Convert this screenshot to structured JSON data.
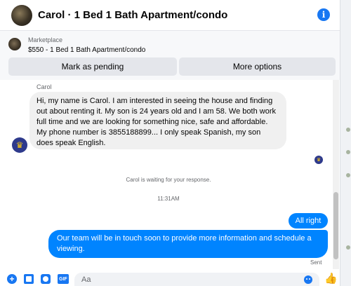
{
  "header": {
    "title": "Carol · 1 Bed 1 Bath Apartment/condo",
    "info_icon": "info-icon",
    "info_glyph": "i"
  },
  "marketplace": {
    "label": "Marketplace",
    "listing": "$550 - 1 Bed 1 Bath Apartment/condo",
    "mark_pending_label": "Mark as pending",
    "more_options_label": "More options"
  },
  "conversation": {
    "sender_name": "Carol",
    "incoming_message": "Hi, my name is Carol. I am interested in seeing the house and finding out about renting it. My son is 24 years old and I am 58. We both work full time and we are looking for something nice, safe and affordable. My phone number is 3855188899... I only speak Spanish, my son does speak English.",
    "waiting_notice": "Carol is waiting for your response.",
    "timestamp": "11:31AM",
    "outgoing_messages": [
      "All right",
      "Our team will be in touch soon to provide more information and schedule a viewing."
    ],
    "status": "Sent"
  },
  "composer": {
    "placeholder": "Aa",
    "gif_label": "GIF",
    "plus_glyph": "+",
    "like_glyph": "👍"
  },
  "colors": {
    "accent": "#1877f2",
    "outgoing_bubble": "#0084ff",
    "incoming_bubble": "#f0f0f0"
  }
}
